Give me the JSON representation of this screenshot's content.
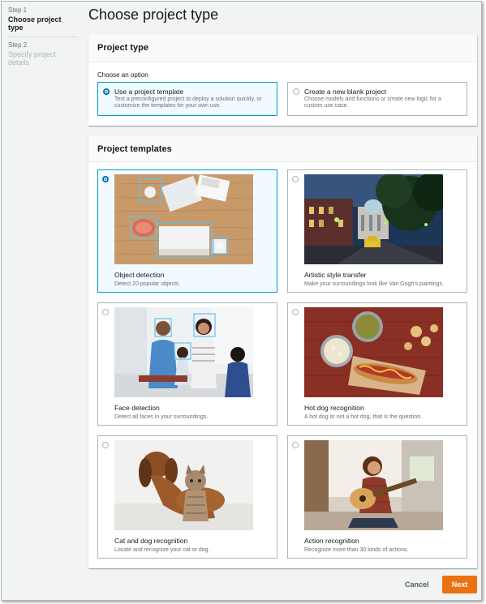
{
  "wizard": {
    "steps": [
      {
        "number": "Step 1",
        "title": "Choose project type"
      },
      {
        "number": "Step 2",
        "title": "Specify project details"
      }
    ]
  },
  "page": {
    "title": "Choose project type"
  },
  "project_type": {
    "header": "Project type",
    "prompt": "Choose an option",
    "options": [
      {
        "title": "Use a project template",
        "description": "Test a preconfigured project to deploy a solution quickly, or customize the templates for your own use.",
        "selected": true
      },
      {
        "title": "Create a new blank project",
        "description": "Choose models and functions or create new logic for a custom use case.",
        "selected": false
      }
    ]
  },
  "templates": {
    "header": "Project templates",
    "items": [
      {
        "title": "Object detection",
        "description": "Detect 20 popular objects.",
        "selected": true,
        "image": "office-desk-photo"
      },
      {
        "title": "Artistic style transfer",
        "description": "Make your surroundings look like Van Gogh's paintings.",
        "selected": false,
        "image": "night-street-photo"
      },
      {
        "title": "Face detection",
        "description": "Detect all faces in your surroundings.",
        "selected": false,
        "image": "family-kitchen-photo"
      },
      {
        "title": "Hot dog recognition",
        "description": "A hot dog or not a hot dog, that is the question.",
        "selected": false,
        "image": "hot-dog-photo"
      },
      {
        "title": "Cat and dog recognition",
        "description": "Locate and recognize your cat or dog.",
        "selected": false,
        "image": "cat-dog-photo"
      },
      {
        "title": "Action recognition",
        "description": "Recognize more than 30 kinds of actions.",
        "selected": false,
        "image": "guitar-player-photo"
      }
    ]
  },
  "footer": {
    "cancel": "Cancel",
    "next": "Next"
  },
  "colors": {
    "accent": "#0073bb",
    "primary_button": "#ec7211",
    "selected_border": "#00a1c9"
  }
}
